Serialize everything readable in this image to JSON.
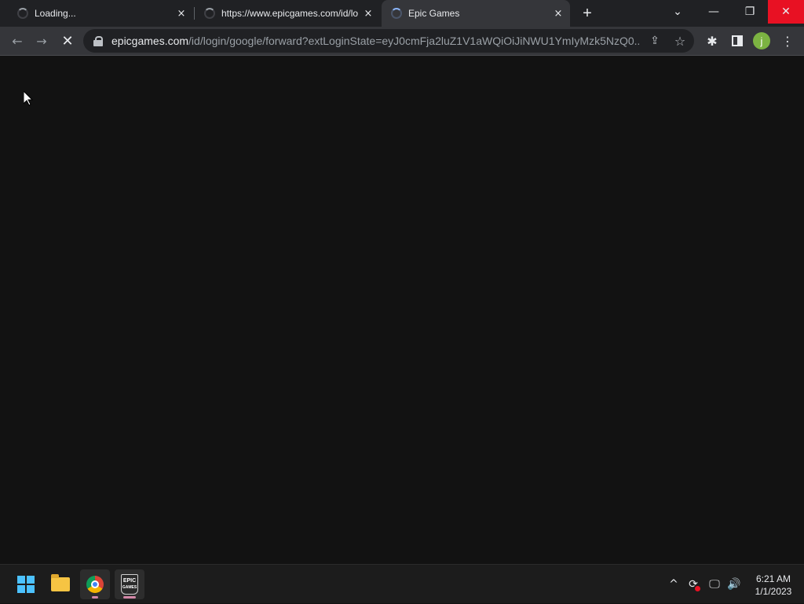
{
  "tabs": [
    {
      "title": "Loading...",
      "active": false
    },
    {
      "title": "https://www.epicgames.com/id/lo",
      "active": false
    },
    {
      "title": "Epic Games",
      "active": true
    }
  ],
  "icons": {
    "tab_close": "×",
    "new_tab": "+",
    "tab_search": "⌄",
    "minimize": "—",
    "restore": "❐",
    "close": "✕",
    "back": "←",
    "forward": "→",
    "stop": "✕",
    "share": "⇪",
    "star": "☆",
    "extensions": "✱",
    "menu": "⋮",
    "tray_chevron": "^",
    "tray_sync": "⟳",
    "tray_network": "🖵",
    "tray_volume": "🔊"
  },
  "address_bar": {
    "domain": "epicgames.com",
    "path": "/id/login/google/forward?extLoginState=eyJ0cmFja2luZ1V1aWQiOiJiNWU1YmIyMzk5NzQ0..."
  },
  "profile": {
    "initial": "j",
    "color": "#7cb342"
  },
  "taskbar": {
    "epic_label_top": "EPIC",
    "epic_label_bottom": "GAMES"
  },
  "clock": {
    "time": "6:21 AM",
    "date": "1/1/2023"
  },
  "colors": {
    "tabstrip": "#202124",
    "toolbar": "#35363a",
    "content": "#121212",
    "taskbar": "#1c1c1c",
    "close_hover": "#e81123",
    "windows_accent": "#4cc2ff"
  }
}
